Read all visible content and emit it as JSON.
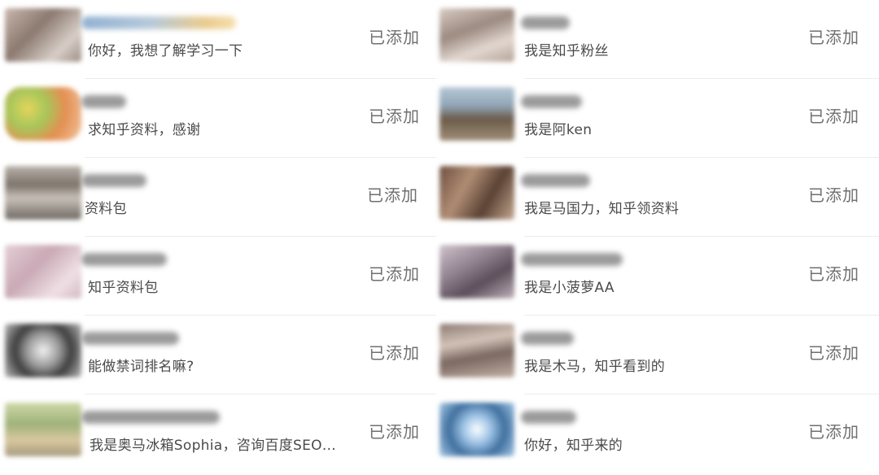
{
  "left_column": [
    {
      "message": "你好，我想了解学习一下",
      "status": "已添加"
    },
    {
      "message": "求知乎资料，感谢",
      "status": "已添加"
    },
    {
      "message": "资料包",
      "status": "已添加"
    },
    {
      "message": "知乎资料包",
      "status": "已添加"
    },
    {
      "message": "能做禁词排名嘛?",
      "status": "已添加"
    },
    {
      "message": "我是奥马冰箱Sophia，咨询百度SEO…",
      "status": "已添加"
    }
  ],
  "right_column": [
    {
      "message": "我是知乎粉丝",
      "status": "已添加"
    },
    {
      "message": "我是阿ken",
      "status": "已添加"
    },
    {
      "message": "我是马国力，知乎领资料",
      "status": "已添加"
    },
    {
      "message": "我是小菠萝AA",
      "status": "已添加"
    },
    {
      "message": "我是木马，知乎看到的",
      "status": "已添加"
    },
    {
      "message": "你好，知乎来的",
      "status": "已添加"
    }
  ],
  "colors": {
    "background": "#ffffff",
    "message_text": "#4a4a4a",
    "status_text": "#6f6f6f",
    "divider": "#ececec"
  }
}
